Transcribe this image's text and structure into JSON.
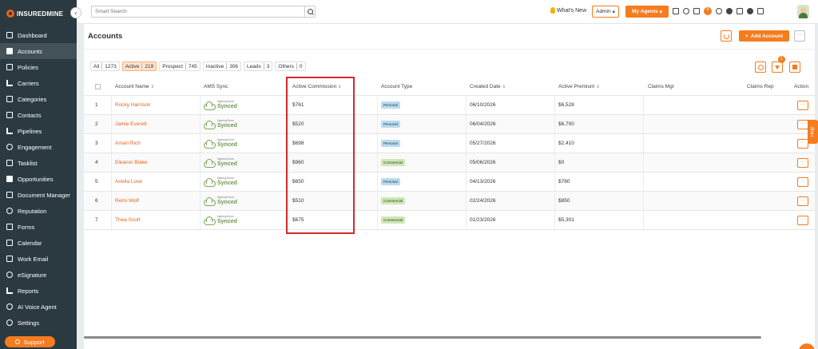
{
  "brand": {
    "logo_text": "INSUREDMINE",
    "collapse_glyph": "‹"
  },
  "sidebar": {
    "items": [
      {
        "label": "Dashboard",
        "icon": "dashboard-icon"
      },
      {
        "label": "Accounts",
        "icon": "accounts-icon",
        "active": true
      },
      {
        "label": "Policies",
        "icon": "policies-icon"
      },
      {
        "label": "Carriers",
        "icon": "carriers-icon"
      },
      {
        "label": "Categories",
        "icon": "categories-icon"
      },
      {
        "label": "Contacts",
        "icon": "contacts-icon"
      },
      {
        "label": "Pipelines",
        "icon": "pipelines-icon"
      },
      {
        "label": "Engagement",
        "icon": "engagement-icon"
      },
      {
        "label": "Tasklist",
        "icon": "tasklist-icon"
      },
      {
        "label": "Opportunities",
        "icon": "opportunities-icon"
      },
      {
        "label": "Document Manager",
        "icon": "folder-icon"
      },
      {
        "label": "Reputation",
        "icon": "reputation-icon"
      },
      {
        "label": "Forms",
        "icon": "forms-icon"
      },
      {
        "label": "Calendar",
        "icon": "calendar-icon"
      },
      {
        "label": "Work Email",
        "icon": "email-icon"
      },
      {
        "label": "eSignature",
        "icon": "signature-icon"
      },
      {
        "label": "Reports",
        "icon": "reports-icon"
      },
      {
        "label": "AI Voice Agent",
        "icon": "voice-agent-icon"
      },
      {
        "label": "Settings",
        "icon": "gear-icon"
      }
    ],
    "support_label": "Support"
  },
  "topbar": {
    "search_placeholder": "Smart Search",
    "whats_new": "What's New",
    "admin_label": "Admin",
    "admin_caret": "▾",
    "my_agents_label": "My Agents",
    "my_agents_caret": "▾",
    "notification_plus": "+"
  },
  "page": {
    "title": "Accounts",
    "add_button": "Add Account",
    "add_plus": "+",
    "more_glyph": "···"
  },
  "filters": [
    {
      "label": "All",
      "count": "1273"
    },
    {
      "label": "Active",
      "count": "219",
      "active": true
    },
    {
      "label": "Prospect",
      "count": "745"
    },
    {
      "label": "Inactive",
      "count": "306"
    },
    {
      "label": "Leads",
      "count": "3"
    },
    {
      "label": "Others",
      "count": "0"
    }
  ],
  "filter_badge": "1",
  "table": {
    "headers": {
      "account_name": "Account Name",
      "ams_sync": "AMS Sync",
      "active_commission": "Active Commission",
      "account_type": "Account Type",
      "created_date": "Created Date",
      "active_premium": "Active Premium",
      "claims_mgr": "Claims Mgr",
      "claims_rep": "Claims Rep",
      "action": "Action"
    },
    "sort_glyph": "⇕",
    "sync_small": "AgencyZoom",
    "sync_label": "Synced",
    "action_glyph": "···",
    "rows": [
      {
        "num": "1",
        "name": "Rocky Harrison",
        "commission": "$761",
        "type": "Personal",
        "date": "06/10/2026",
        "premium": "$6,528"
      },
      {
        "num": "2",
        "name": "Jamie Everett",
        "commission": "$520",
        "type": "Personal",
        "date": "06/04/2026",
        "premium": "$6,700"
      },
      {
        "num": "3",
        "name": "Amari Rich",
        "commission": "$698",
        "type": "Personal",
        "date": "05/27/2026",
        "premium": "$2,410"
      },
      {
        "num": "4",
        "name": "Eleanor Blake",
        "commission": "$960",
        "type": "Commercial",
        "date": "05/06/2026",
        "premium": "$0"
      },
      {
        "num": "5",
        "name": "Ariella Love",
        "commission": "$650",
        "type": "Personal",
        "date": "04/13/2026",
        "premium": "$780"
      },
      {
        "num": "6",
        "name": "Remi Wolf",
        "commission": "$510",
        "type": "Commercial",
        "date": "02/24/2026",
        "premium": "$850"
      },
      {
        "num": "7",
        "name": "Thea Scott",
        "commission": "$675",
        "type": "Commercial",
        "date": "01/23/2026",
        "premium": "$5,301"
      }
    ]
  },
  "help_label": "Help"
}
